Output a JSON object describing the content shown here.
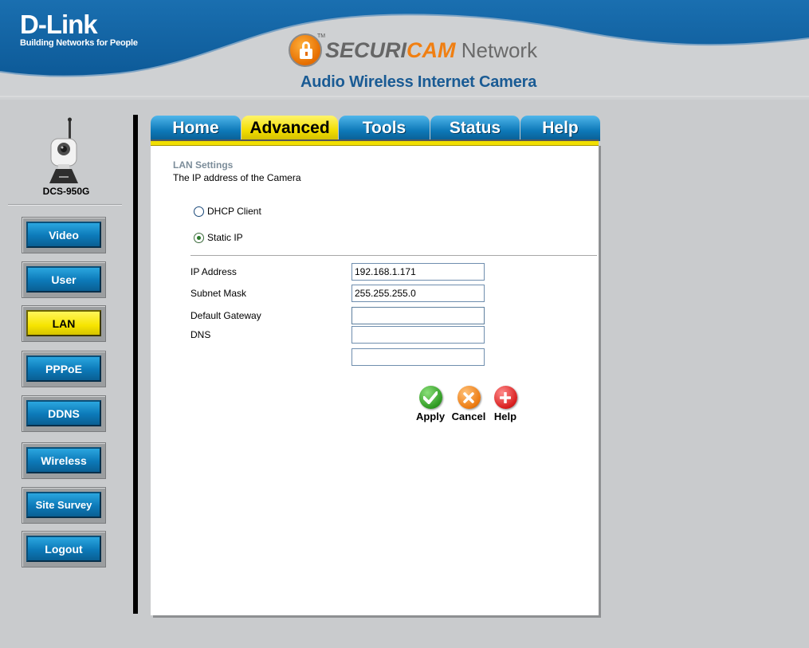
{
  "header": {
    "brand_name": "D-Link",
    "brand_tagline": "Building Networks for People",
    "product_secur": "SECURI",
    "product_cam": "CAM",
    "product_network": " Network",
    "product_tm": "TM",
    "subtitle": "Audio Wireless Internet Camera"
  },
  "device": {
    "model": "DCS-950G"
  },
  "sidebar": {
    "items": [
      {
        "label": "Video",
        "active": false
      },
      {
        "label": "User",
        "active": false
      },
      {
        "label": "LAN",
        "active": true
      },
      {
        "label": "PPPoE",
        "active": false
      },
      {
        "label": "DDNS",
        "active": false
      },
      {
        "label": "Wireless",
        "active": false
      },
      {
        "label": "Site Survey",
        "active": false
      },
      {
        "label": "Logout",
        "active": false
      }
    ]
  },
  "tabs": [
    {
      "label": "Home",
      "active": false
    },
    {
      "label": "Advanced",
      "active": true
    },
    {
      "label": "Tools",
      "active": false
    },
    {
      "label": "Status",
      "active": false
    },
    {
      "label": "Help",
      "active": false
    }
  ],
  "lan": {
    "title": "LAN Settings",
    "description": "The IP address of the Camera",
    "mode_options": [
      {
        "label": "DHCP Client",
        "checked": false
      },
      {
        "label": "Static IP",
        "checked": true
      }
    ],
    "fields": {
      "ip_label": "IP Address",
      "ip_value": "192.168.1.171",
      "subnet_label": "Subnet Mask",
      "subnet_value": "255.255.255.0",
      "gateway_label": "Default Gateway",
      "gateway_value": "",
      "dns_label": "DNS",
      "dns1_value": "",
      "dns2_value": ""
    }
  },
  "actions": {
    "apply": "Apply",
    "cancel": "Cancel",
    "help": "Help",
    "apply_icon": "check-icon",
    "cancel_icon": "x-icon",
    "help_icon": "plus-icon"
  },
  "colors": {
    "header_blue": "#1367a8",
    "accent_yellow": "#f1df00",
    "button_blue": "#0c79b8",
    "background": "#c9cbcd"
  }
}
